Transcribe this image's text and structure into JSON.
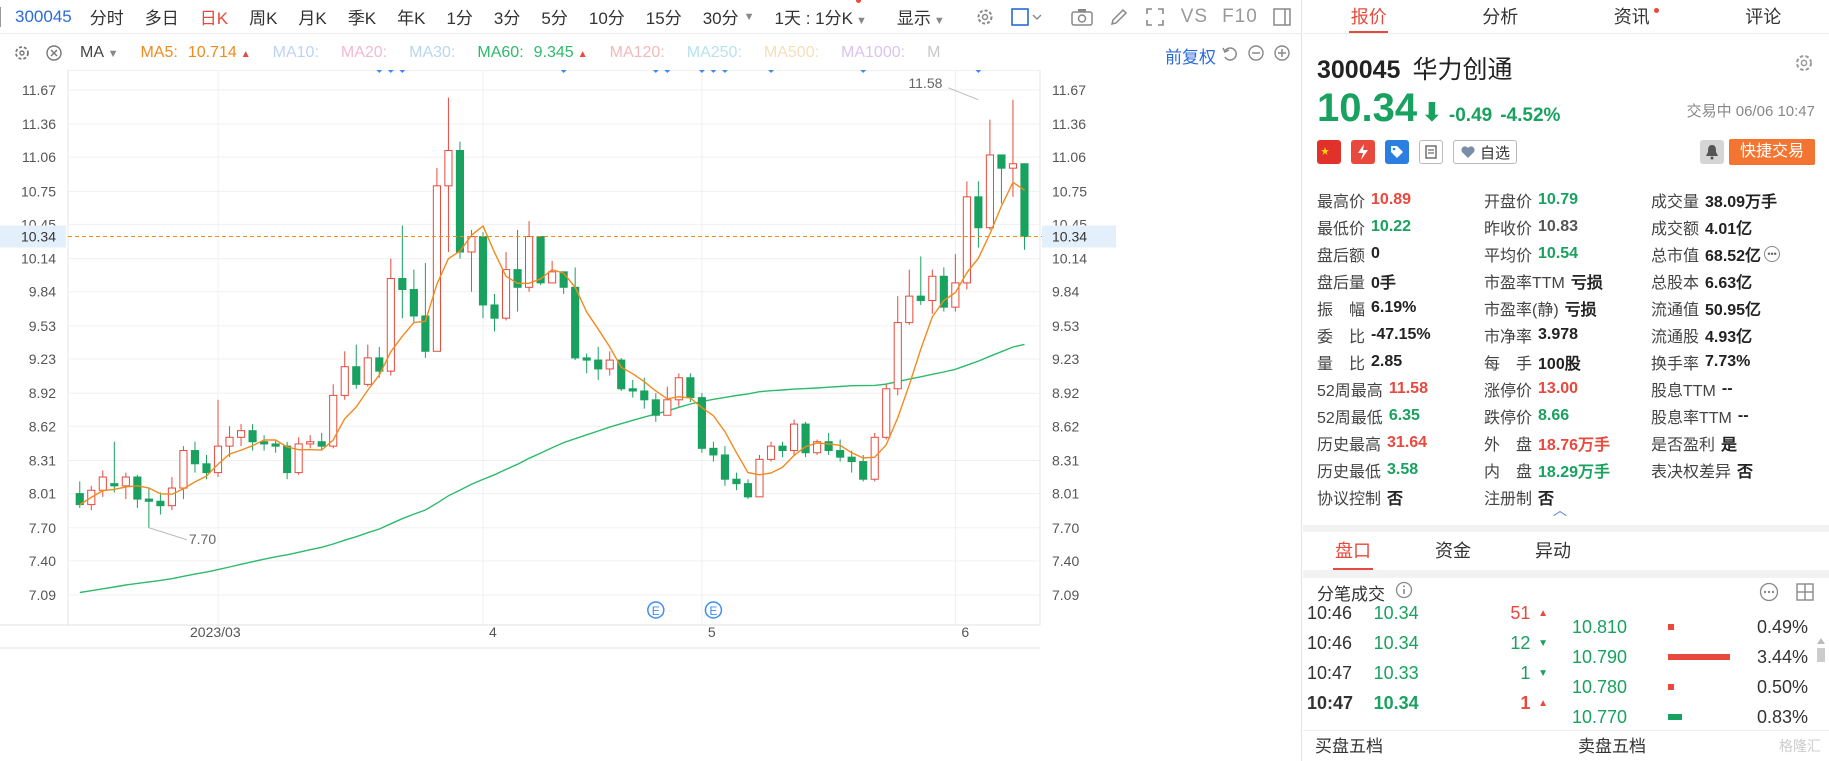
{
  "toolbar": {
    "code": "300045",
    "periods": [
      "分时",
      "多日",
      "日K",
      "周K",
      "月K",
      "季K",
      "年K",
      "1分",
      "3分",
      "5分",
      "10分",
      "15分",
      "30分"
    ],
    "active_period": "日K",
    "range_select": "1天 : 1分K",
    "display_label": "显示",
    "vs_label": "VS",
    "f10_label": "F10"
  },
  "ma_row": {
    "label": "MA",
    "items": [
      {
        "name": "MA5:",
        "value": "10.714",
        "color": "#f28a1e",
        "active": true,
        "up": true
      },
      {
        "name": "MA10:",
        "value": "",
        "color": "#bcd3f5",
        "active": false
      },
      {
        "name": "MA20:",
        "value": "",
        "color": "#f3b9d1",
        "active": false
      },
      {
        "name": "MA30:",
        "value": "",
        "color": "#b6d7ef",
        "active": false
      },
      {
        "name": "MA60:",
        "value": "9.345",
        "color": "#2cbb6a",
        "active": true,
        "up": true
      },
      {
        "name": "MA120:",
        "value": "",
        "color": "#f3b9b9",
        "active": false
      },
      {
        "name": "MA250:",
        "value": "",
        "color": "#b6e3ef",
        "active": false
      },
      {
        "name": "MA500:",
        "value": "",
        "color": "#f5deb8",
        "active": false
      },
      {
        "name": "MA1000:",
        "value": "",
        "color": "#d9c3ef",
        "active": false
      },
      {
        "name": "M",
        "value": "",
        "color": "#c8c8c8",
        "active": false
      }
    ],
    "adjust_label": "前复权"
  },
  "chart_data": {
    "type": "candlestick",
    "y_ticks": [
      "11.67",
      "11.36",
      "11.06",
      "10.75",
      "10.45",
      "10.14",
      "9.84",
      "9.53",
      "9.23",
      "8.92",
      "8.62",
      "8.31",
      "8.01",
      "7.70",
      "7.40",
      "7.09"
    ],
    "ylim": [
      6.9,
      11.85
    ],
    "x_labels": [
      {
        "label": "2023/03",
        "index": 12
      },
      {
        "label": "4",
        "index": 35
      },
      {
        "label": "5",
        "index": 54
      },
      {
        "label": "6",
        "index": 76
      }
    ],
    "current_price": 10.34,
    "current_price_label": "10.34",
    "high_annotation": {
      "label": "11.58",
      "index": 78,
      "value": 11.58
    },
    "low_annotation": {
      "label": "7.70",
      "index": 6,
      "value": 7.7
    },
    "event_marker_label": "E",
    "events": [
      50,
      55
    ],
    "dividend_markers": [
      26,
      27,
      28,
      42,
      50,
      51,
      54,
      55,
      56,
      60,
      68,
      78
    ],
    "candles": [
      [
        8.01,
        7.91,
        8.12,
        7.88
      ],
      [
        7.91,
        8.04,
        8.08,
        7.86
      ],
      [
        8.04,
        8.16,
        8.22,
        7.98
      ],
      [
        8.1,
        8.08,
        8.48,
        8.02
      ],
      [
        8.08,
        8.16,
        8.2,
        7.96
      ],
      [
        8.16,
        7.96,
        8.18,
        7.88
      ],
      [
        7.96,
        7.94,
        8.06,
        7.7
      ],
      [
        7.94,
        7.9,
        8.02,
        7.82
      ],
      [
        7.9,
        8.06,
        8.16,
        7.86
      ],
      [
        8.06,
        8.4,
        8.44,
        7.96
      ],
      [
        8.4,
        8.28,
        8.48,
        8.2
      ],
      [
        8.28,
        8.2,
        8.36,
        8.14
      ],
      [
        8.2,
        8.44,
        8.86,
        8.16
      ],
      [
        8.44,
        8.52,
        8.62,
        8.34
      ],
      [
        8.52,
        8.58,
        8.64,
        8.44
      ],
      [
        8.58,
        8.48,
        8.64,
        8.4
      ],
      [
        8.48,
        8.46,
        8.54,
        8.4
      ],
      [
        8.46,
        8.44,
        8.5,
        8.38
      ],
      [
        8.44,
        8.2,
        8.48,
        8.14
      ],
      [
        8.2,
        8.46,
        8.52,
        8.18
      ],
      [
        8.46,
        8.48,
        8.54,
        8.42
      ],
      [
        8.48,
        8.44,
        8.56,
        8.4
      ],
      [
        8.44,
        8.9,
        9.0,
        8.42
      ],
      [
        8.9,
        9.16,
        9.3,
        8.86
      ],
      [
        9.16,
        9.0,
        9.36,
        8.96
      ],
      [
        9.0,
        9.24,
        9.36,
        8.98
      ],
      [
        9.24,
        9.12,
        9.34,
        9.06
      ],
      [
        9.12,
        9.96,
        10.14,
        9.08
      ],
      [
        9.96,
        9.86,
        10.44,
        9.6
      ],
      [
        9.86,
        9.62,
        10.04,
        9.56
      ],
      [
        9.62,
        9.3,
        10.1,
        9.24
      ],
      [
        9.3,
        10.8,
        10.96,
        9.4
      ],
      [
        10.8,
        11.12,
        11.6,
        10.2
      ],
      [
        11.12,
        10.2,
        11.2,
        10.14
      ],
      [
        10.2,
        10.34,
        10.4,
        9.84
      ],
      [
        10.34,
        9.72,
        10.38,
        9.6
      ],
      [
        9.72,
        9.6,
        9.82,
        9.48
      ],
      [
        9.6,
        10.04,
        10.2,
        9.58
      ],
      [
        10.04,
        9.88,
        10.4,
        9.66
      ],
      [
        9.88,
        10.34,
        10.48,
        9.84
      ],
      [
        10.34,
        9.92,
        10.34,
        9.9
      ],
      [
        9.92,
        10.02,
        10.12,
        9.92
      ],
      [
        10.02,
        9.88,
        10.0,
        9.82
      ],
      [
        9.88,
        9.24,
        10.06,
        9.22
      ],
      [
        9.24,
        9.22,
        9.28,
        9.1
      ],
      [
        9.22,
        9.14,
        9.34,
        9.04
      ],
      [
        9.14,
        9.22,
        9.3,
        9.08
      ],
      [
        9.22,
        8.96,
        9.24,
        8.94
      ],
      [
        8.96,
        8.94,
        9.04,
        8.88
      ],
      [
        8.94,
        8.86,
        9.06,
        8.78
      ],
      [
        8.86,
        8.72,
        8.92,
        8.66
      ],
      [
        8.72,
        8.86,
        8.98,
        8.72
      ],
      [
        8.86,
        9.06,
        9.1,
        8.8
      ],
      [
        9.06,
        8.88,
        9.1,
        8.84
      ],
      [
        8.88,
        8.42,
        8.92,
        8.38
      ],
      [
        8.42,
        8.36,
        8.48,
        8.3
      ],
      [
        8.36,
        8.14,
        8.44,
        8.08
      ],
      [
        8.14,
        8.1,
        8.2,
        8.04
      ],
      [
        8.1,
        7.98,
        8.14,
        7.96
      ],
      [
        7.98,
        8.32,
        8.36,
        7.98
      ],
      [
        8.32,
        8.44,
        8.48,
        8.3
      ],
      [
        8.44,
        8.4,
        8.48,
        8.34
      ],
      [
        8.4,
        8.64,
        8.68,
        8.36
      ],
      [
        8.64,
        8.38,
        8.66,
        8.34
      ],
      [
        8.38,
        8.48,
        8.5,
        8.36
      ],
      [
        8.48,
        8.4,
        8.56,
        8.36
      ],
      [
        8.4,
        8.34,
        8.5,
        8.3
      ],
      [
        8.34,
        8.3,
        8.4,
        8.2
      ],
      [
        8.3,
        8.14,
        8.36,
        8.12
      ],
      [
        8.14,
        8.52,
        8.56,
        8.12
      ],
      [
        8.52,
        8.96,
        9.0,
        8.5
      ],
      [
        8.96,
        9.56,
        9.8,
        8.9
      ],
      [
        9.56,
        9.8,
        10.04,
        9.54
      ],
      [
        9.8,
        9.76,
        10.16,
        9.72
      ],
      [
        9.76,
        9.98,
        10.04,
        9.64
      ],
      [
        9.98,
        9.7,
        10.06,
        9.66
      ],
      [
        9.7,
        9.92,
        10.18,
        9.66
      ],
      [
        9.92,
        10.7,
        10.84,
        9.86
      ],
      [
        10.7,
        10.42,
        10.84,
        10.24
      ],
      [
        10.42,
        11.08,
        11.4,
        10.4
      ],
      [
        11.08,
        10.96,
        11.04,
        10.64
      ],
      [
        10.96,
        11.0,
        11.58,
        10.7
      ],
      [
        11.0,
        10.34,
        10.89,
        10.22
      ]
    ],
    "ma5_color": "#f28a1e",
    "ma60_color": "#2cbb6a"
  },
  "quote": {
    "tabs": [
      {
        "label": "报价",
        "active": true
      },
      {
        "label": "分析",
        "active": false
      },
      {
        "label": "资讯",
        "active": false,
        "dot": true
      },
      {
        "label": "评论",
        "active": false
      }
    ],
    "code": "300045",
    "name": "华力创通",
    "price": "10.34",
    "change": "-0.49",
    "change_pct": "-4.52%",
    "trade_time": "交易中 06/06 10:47",
    "zixuan_label": "自选",
    "quick_trade_label": "快捷交易",
    "stats": [
      [
        {
          "l": "最高价",
          "v": "10.89",
          "c": "red"
        },
        {
          "l": "开盘价",
          "v": "10.79",
          "c": "green"
        },
        {
          "l": "成交量",
          "v": "38.09万手",
          "c": ""
        }
      ],
      [
        {
          "l": "最低价",
          "v": "10.22",
          "c": "green"
        },
        {
          "l": "昨收价",
          "v": "10.83",
          "c": "gray"
        },
        {
          "l": "成交额",
          "v": "4.01亿",
          "c": ""
        }
      ],
      [
        {
          "l": "盘后额",
          "v": "0",
          "c": ""
        },
        {
          "l": "平均价",
          "v": "10.54",
          "c": "green"
        },
        {
          "l": "总市值",
          "v": "68.52亿",
          "c": "",
          "more": true
        }
      ],
      [
        {
          "l": "盘后量",
          "v": "0手",
          "c": ""
        },
        {
          "l": "市盈率TTM",
          "v": "亏损",
          "c": ""
        },
        {
          "l": "总股本",
          "v": "6.63亿",
          "c": ""
        }
      ],
      [
        {
          "l": "振　幅",
          "v": "6.19%",
          "c": ""
        },
        {
          "l": "市盈率(静)",
          "v": "亏损",
          "c": ""
        },
        {
          "l": "流通值",
          "v": "50.95亿",
          "c": ""
        }
      ],
      [
        {
          "l": "委　比",
          "v": "-47.15%",
          "c": ""
        },
        {
          "l": "市净率",
          "v": "3.978",
          "c": ""
        },
        {
          "l": "流通股",
          "v": "4.93亿",
          "c": ""
        }
      ],
      [
        {
          "l": "量　比",
          "v": "2.85",
          "c": ""
        },
        {
          "l": "每　手",
          "v": "100股",
          "c": ""
        },
        {
          "l": "换手率",
          "v": "7.73%",
          "c": ""
        }
      ],
      [
        {
          "l": "52周最高",
          "v": "11.58",
          "c": "red"
        },
        {
          "l": "涨停价",
          "v": "13.00",
          "c": "red"
        },
        {
          "l": "股息TTM",
          "v": "--",
          "c": ""
        }
      ],
      [
        {
          "l": "52周最低",
          "v": "6.35",
          "c": "green"
        },
        {
          "l": "跌停价",
          "v": "8.66",
          "c": "green"
        },
        {
          "l": "股息率TTM",
          "v": "--",
          "c": ""
        }
      ],
      [
        {
          "l": "历史最高",
          "v": "31.64",
          "c": "red"
        },
        {
          "l": "外　盘",
          "v": "18.76万手",
          "c": "red"
        },
        {
          "l": "是否盈利",
          "v": "是",
          "c": ""
        }
      ],
      [
        {
          "l": "历史最低",
          "v": "3.58",
          "c": "green"
        },
        {
          "l": "内　盘",
          "v": "18.29万手",
          "c": "green"
        },
        {
          "l": "表决权差异",
          "v": "否",
          "c": ""
        }
      ],
      [
        {
          "l": "协议控制",
          "v": "否",
          "c": ""
        },
        {
          "l": "注册制",
          "v": "否",
          "c": ""
        },
        {
          "l": "",
          "v": "",
          "c": ""
        }
      ]
    ],
    "sub_tabs": [
      {
        "label": "盘口",
        "active": true
      },
      {
        "label": "资金",
        "active": false
      },
      {
        "label": "异动",
        "active": false
      }
    ],
    "tick_title": "分笔成交",
    "ticks": [
      {
        "t": "10:46",
        "p": "10.34",
        "v": "51",
        "dir": "up",
        "bold": false
      },
      {
        "t": "10:46",
        "p": "10.34",
        "v": "12",
        "dir": "down",
        "bold": false
      },
      {
        "t": "10:47",
        "p": "10.33",
        "v": "1",
        "dir": "down",
        "bold": false
      },
      {
        "t": "10:47",
        "p": "10.34",
        "v": "1",
        "dir": "up",
        "bold": true
      }
    ],
    "depth": [
      {
        "p": "10.810",
        "pct": "0.49%",
        "bar": 0.08,
        "color": "#e8493c"
      },
      {
        "p": "10.790",
        "pct": "3.44%",
        "bar": 0.82,
        "color": "#e8493c"
      },
      {
        "p": "10.780",
        "pct": "0.50%",
        "bar": 0.08,
        "color": "#e8493c"
      },
      {
        "p": "10.770",
        "pct": "0.83%",
        "bar": 0.18,
        "color": "#19a15f"
      }
    ],
    "buy_head": "买盘五档",
    "sell_head": "卖盘五档",
    "watermark": "格隆汇"
  }
}
